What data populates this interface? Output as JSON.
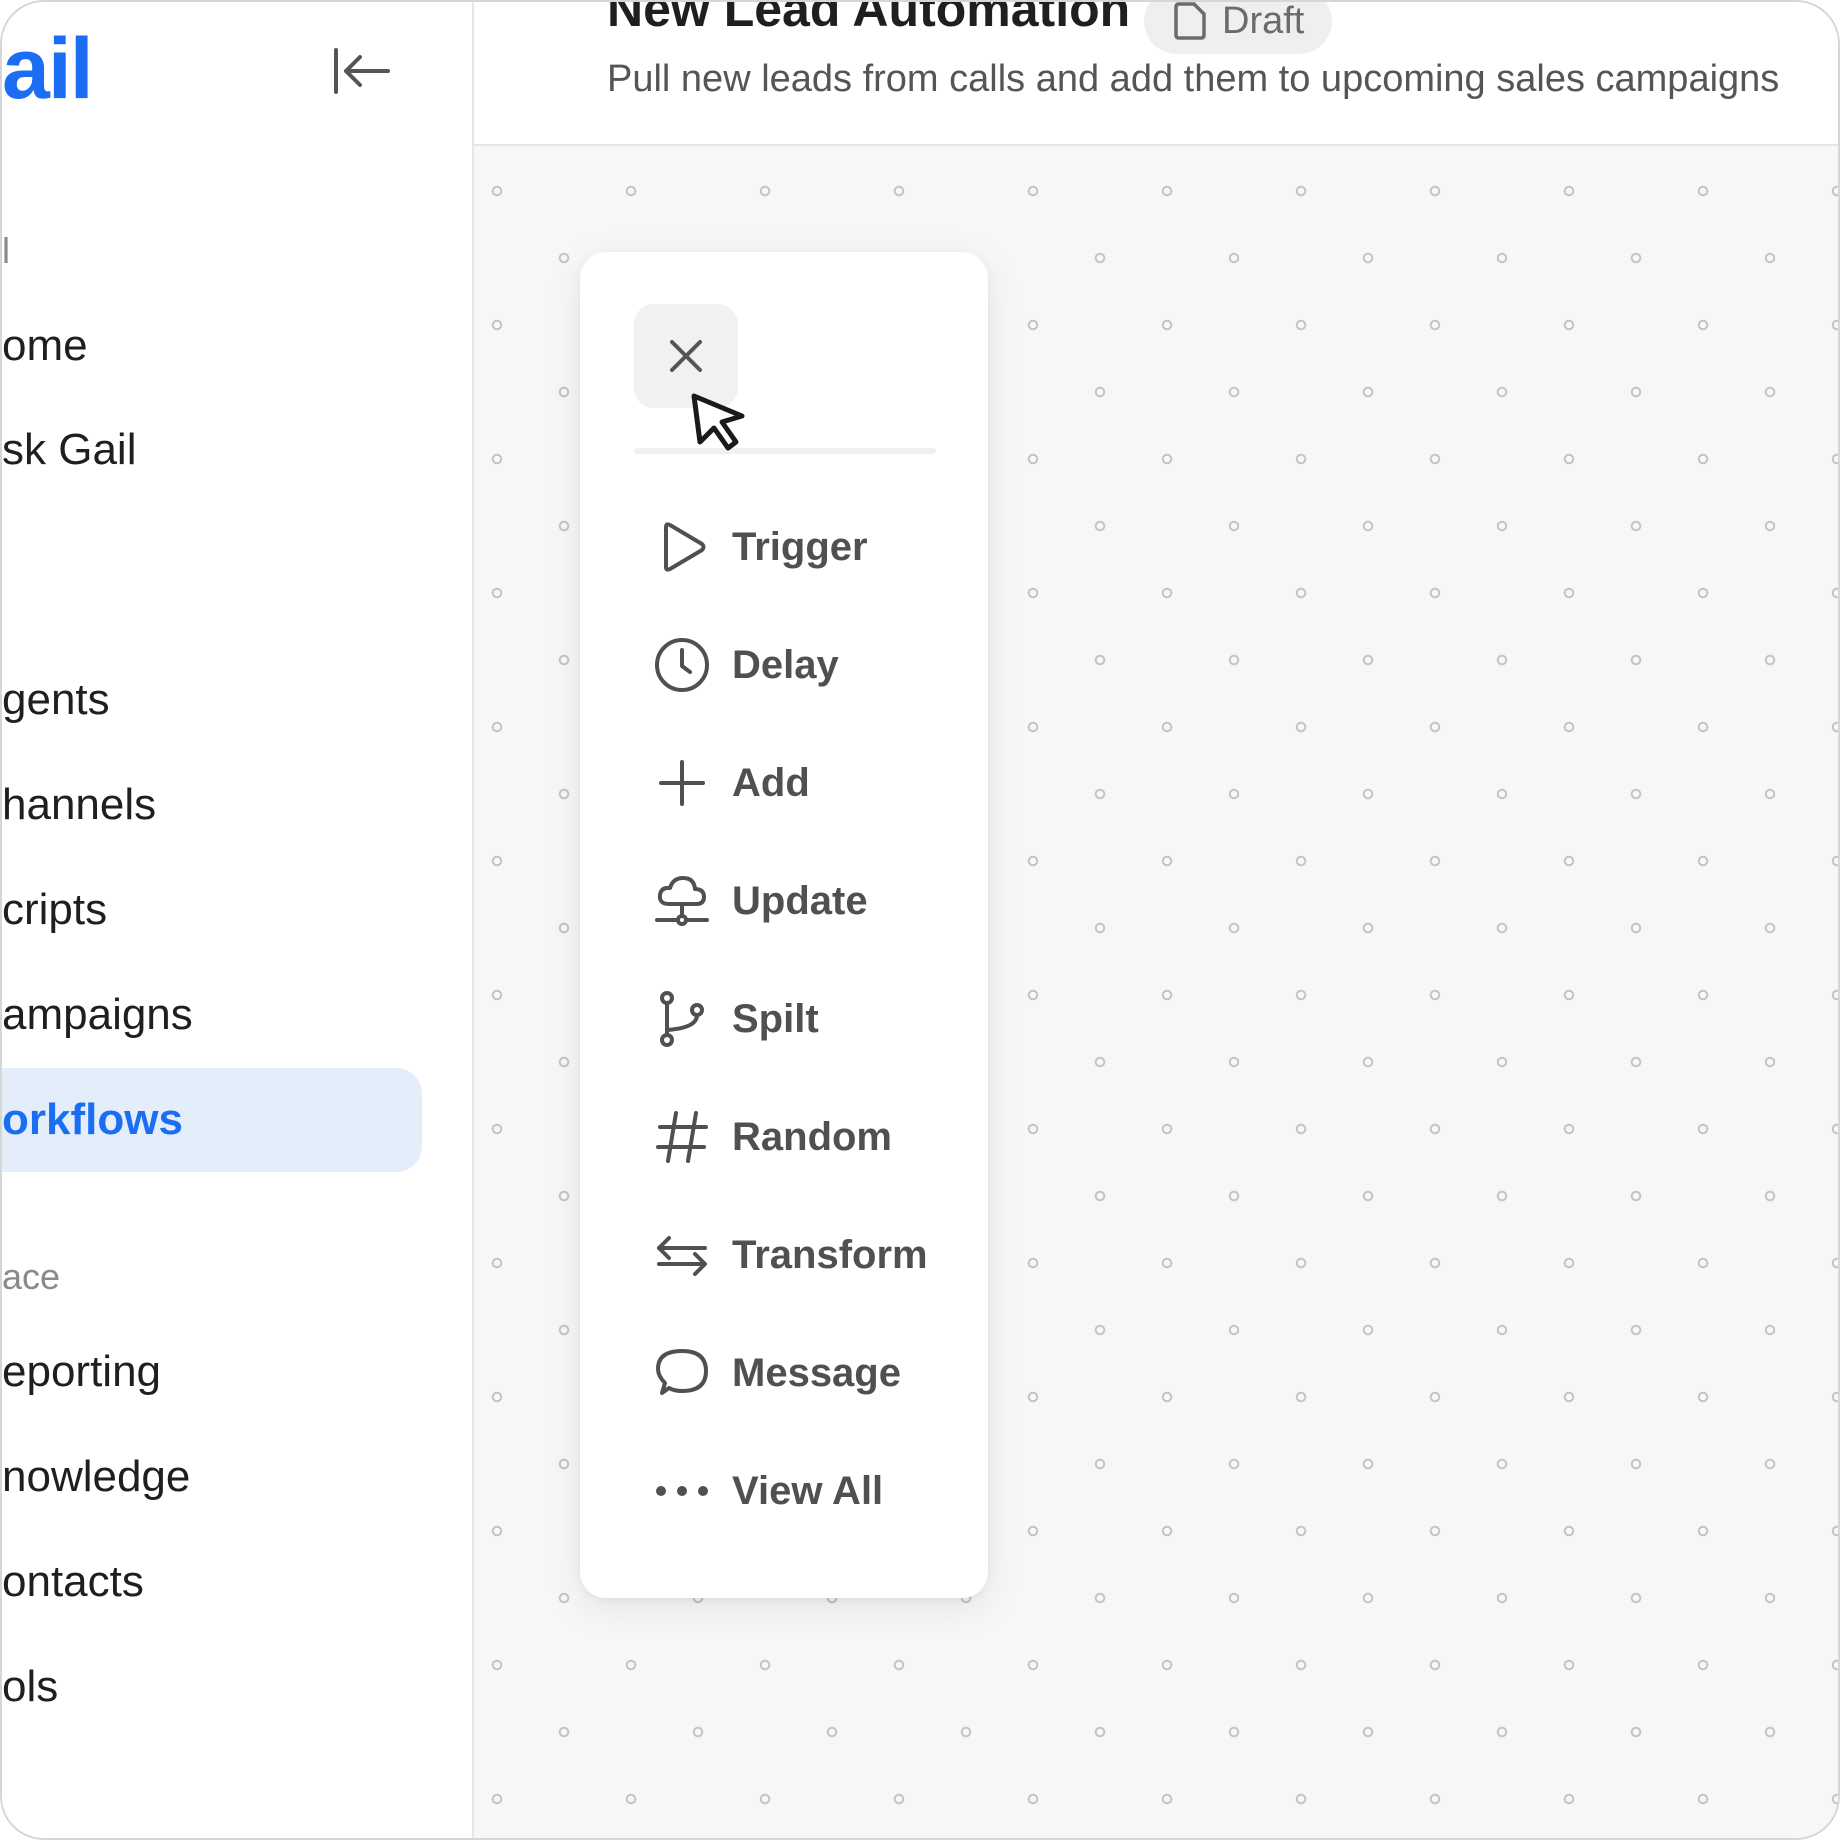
{
  "sidebar": {
    "logo": "ail",
    "section_top": "l",
    "section_workspace": "ace",
    "items": [
      {
        "label": "ome"
      },
      {
        "label": "sk Gail"
      },
      {
        "label": "gents"
      },
      {
        "label": "hannels"
      },
      {
        "label": "cripts"
      },
      {
        "label": "ampaigns"
      },
      {
        "label": "orkflows",
        "active": true
      },
      {
        "label": "eporting"
      },
      {
        "label": "nowledge"
      },
      {
        "label": "ontacts"
      },
      {
        "label": "ols"
      }
    ]
  },
  "header": {
    "title": "New Lead Automation",
    "status": "Draft",
    "subtitle": "Pull new leads from calls and add them to upcoming sales campaigns"
  },
  "menu": {
    "items": [
      {
        "label": "Trigger",
        "icon": "play-icon"
      },
      {
        "label": "Delay",
        "icon": "clock-icon"
      },
      {
        "label": "Add",
        "icon": "plus-icon"
      },
      {
        "label": "Update",
        "icon": "cloud-network-icon"
      },
      {
        "label": "Spilt",
        "icon": "branch-icon"
      },
      {
        "label": "Random",
        "icon": "hash-icon"
      },
      {
        "label": "Transform",
        "icon": "swap-arrows-icon"
      },
      {
        "label": "Message",
        "icon": "chat-bubble-icon"
      },
      {
        "label": "View All",
        "icon": "more-dots-icon"
      }
    ]
  },
  "colors": {
    "brand": "#1b6ef3",
    "active_bg": "#e4eefb",
    "canvas_bg": "#f7f7f7",
    "icon": "#505050"
  }
}
